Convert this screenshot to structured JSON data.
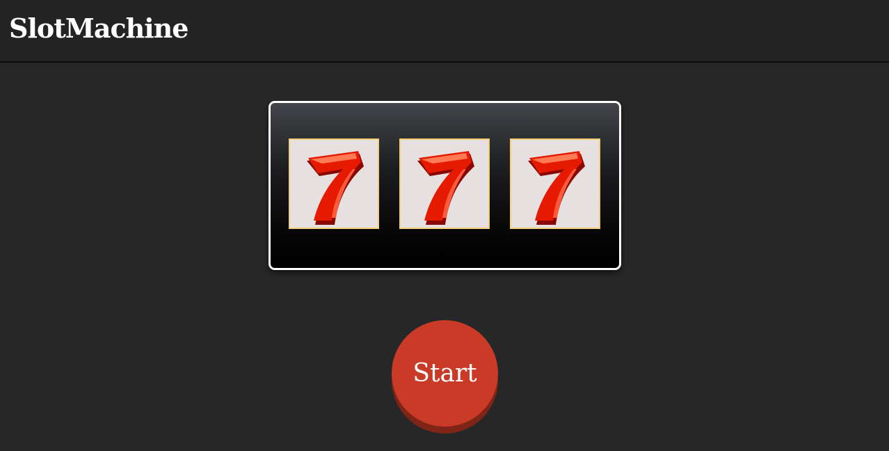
{
  "header": {
    "title": "SlotMachine"
  },
  "reels": [
    {
      "symbol": "7",
      "icon": "seven-icon"
    },
    {
      "symbol": "7",
      "icon": "seven-icon"
    },
    {
      "symbol": "7",
      "icon": "seven-icon"
    }
  ],
  "controls": {
    "start_label": "Start"
  },
  "colors": {
    "background": "#272727",
    "header_background": "#232323",
    "reel_border": "#f4cf78",
    "reel_face": "#e6e0e0",
    "seven_red": "#e51a00",
    "start_button": "#c93a27"
  }
}
